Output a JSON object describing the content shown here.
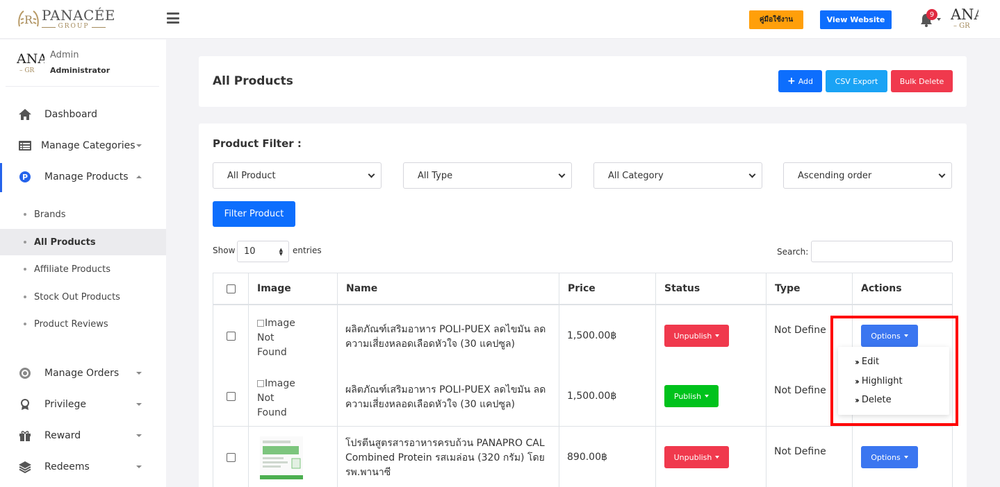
{
  "header": {
    "logo_brand": "PANACÉE",
    "logo_group": "GROUP",
    "manual_button": "คู่มือใช้งาน",
    "website_button": "View Website",
    "notifications_count": "9",
    "avatar_text_1": "ANA",
    "avatar_text_2": "– GR"
  },
  "sidebar": {
    "user_name": "Admin",
    "user_role": "Administrator",
    "avatar_text_1": "ANA",
    "avatar_text_2": "– GR",
    "items": [
      {
        "label": "Dashboard",
        "icon": "home-icon"
      },
      {
        "label": "Manage Categories",
        "icon": "list-icon"
      },
      {
        "label": "Manage Products",
        "icon": "product-p-icon"
      },
      {
        "label": "Manage Orders",
        "icon": "orders-icon"
      },
      {
        "label": "Privilege",
        "icon": "privilege-icon"
      },
      {
        "label": "Reward",
        "icon": "gift-icon"
      },
      {
        "label": "Redeems",
        "icon": "layers-icon"
      }
    ],
    "sub_items": [
      {
        "label": "Brands"
      },
      {
        "label": "All Products"
      },
      {
        "label": "Affiliate Products"
      },
      {
        "label": "Stock Out Products"
      },
      {
        "label": "Product Reviews"
      }
    ]
  },
  "page": {
    "title": "All Products",
    "add_button": "Add",
    "csv_button": "CSV Export",
    "bulk_delete_button": "Bulk Delete"
  },
  "filter": {
    "label": "Product Filter :",
    "selects": [
      "All Product",
      "All Type",
      "All Category",
      "Ascending order"
    ],
    "filter_button": "Filter Product",
    "show_label": "Show",
    "entries_value": "10",
    "entries_label": "entries",
    "search_label": "Search:"
  },
  "table": {
    "headers": [
      "Image",
      "Name",
      "Price",
      "Status",
      "Type",
      "Actions"
    ],
    "rows": [
      {
        "image_alt": [
          "Image",
          "Not",
          "Found"
        ],
        "name": [
          "ผลิตภัณฑ์เสริมอาหาร POLI-PUEX ลดไขมัน ลด",
          "ความเสี่ยงหลอดเลือดหัวใจ (30 แคปซูล)"
        ],
        "price": "1,500.00฿",
        "status": "Unpublish",
        "type": "Not Define",
        "action": "Options"
      },
      {
        "image_alt": [
          "Image",
          "Not",
          "Found"
        ],
        "name": [
          "ผลิตภัณฑ์เสริมอาหาร POLI-PUEX ลดไขมัน ลด",
          "ความเสี่ยงหลอดเลือดหัวใจ (30 แคปซูล)"
        ],
        "price": "1,500.00฿",
        "status": "Publish",
        "type": "Not Define",
        "action": "Options"
      },
      {
        "image_alt": [],
        "name": [
          "โปรตีนสูตรสารอาหารครบถ้วน PANAPRO CAL",
          "Combined Protein รสเมล่อน (320 กรัม) โดย",
          "รพ.พานาซี"
        ],
        "price": "890.00฿",
        "status": "Unpublish",
        "type": "Not Define",
        "action": "Options"
      }
    ]
  },
  "dropdown": {
    "items": [
      "Edit",
      "Highlight",
      "Delete"
    ]
  },
  "colors": {
    "primary": "#0d6efd",
    "info": "#1aa3f5",
    "danger": "#f0394d",
    "success": "#00c21c",
    "warning": "#ff9f0a",
    "annotation": "#ff0000"
  }
}
